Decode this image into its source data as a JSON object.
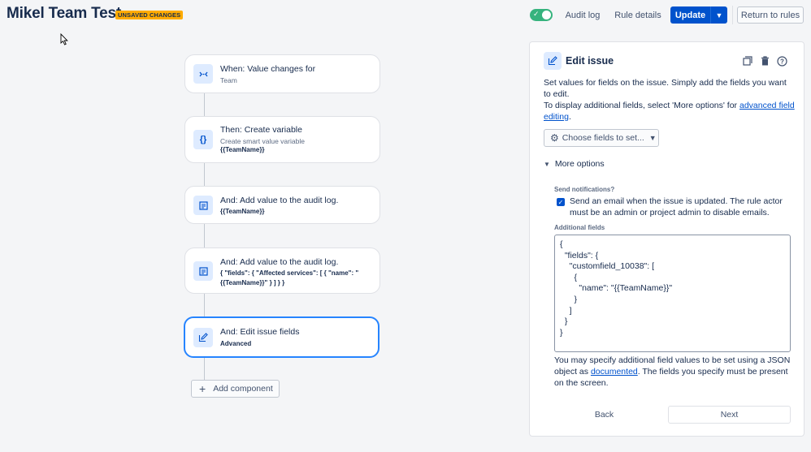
{
  "header": {
    "title": "Mikel Team Test",
    "badge": "UNSAVED CHANGES",
    "audit_log": "Audit log",
    "rule_details": "Rule details",
    "update": "Update",
    "return": "Return to rules",
    "rule_enabled": true
  },
  "flow": {
    "steps": [
      {
        "icon": "value-change-icon",
        "title": "When: Value changes for",
        "sub": "Team"
      },
      {
        "icon": "code-braces-icon",
        "title": "Then: Create variable",
        "sub": "Create smart value variable",
        "strong": "{{TeamName}}"
      },
      {
        "icon": "audit-log-icon",
        "title": "And: Add value to the audit log.",
        "strong": "{{TeamName}}"
      },
      {
        "icon": "audit-log-icon",
        "title": "And: Add value to the audit log.",
        "strong": "{ \"fields\": { \"Affected services\": [ { \"name\": \"{{TeamName}}\" } ] } }"
      },
      {
        "icon": "edit-icon",
        "title": "And: Edit issue fields",
        "strong": "Advanced"
      }
    ],
    "add_component": "Add component"
  },
  "panel": {
    "title": "Edit issue",
    "desc_1": "Set values for fields on the issue. Simply add the fields you want to edit.",
    "desc_2": "To display additional fields, select 'More options' for",
    "desc_link": "advanced field editing",
    "desc_end": ".",
    "choose_fields": "Choose fields to set...",
    "more_options": "More options",
    "send_notifications_label": "Send notifications?",
    "send_notifications_text": "Send an email when the issue is updated. The rule actor must be an admin or project admin to disable emails.",
    "send_notifications_checked": true,
    "additional_fields_label": "Additional fields",
    "additional_fields_value": "{\n  \"fields\": {\n    \"customfield_10038\": [\n      {\n        \"name\": \"{{TeamName}}\"\n      }\n    ]\n  }\n}",
    "help_1": "You may specify additional field values to be set using a JSON object as",
    "help_link": "documented",
    "help_2": ". The fields you specify must be present on the screen.",
    "back": "Back",
    "next": "Next"
  },
  "colors": {
    "primary": "#0052cc",
    "badge": "#ffab00",
    "toggle_on": "#36b37e",
    "selected_border": "#2684ff"
  }
}
